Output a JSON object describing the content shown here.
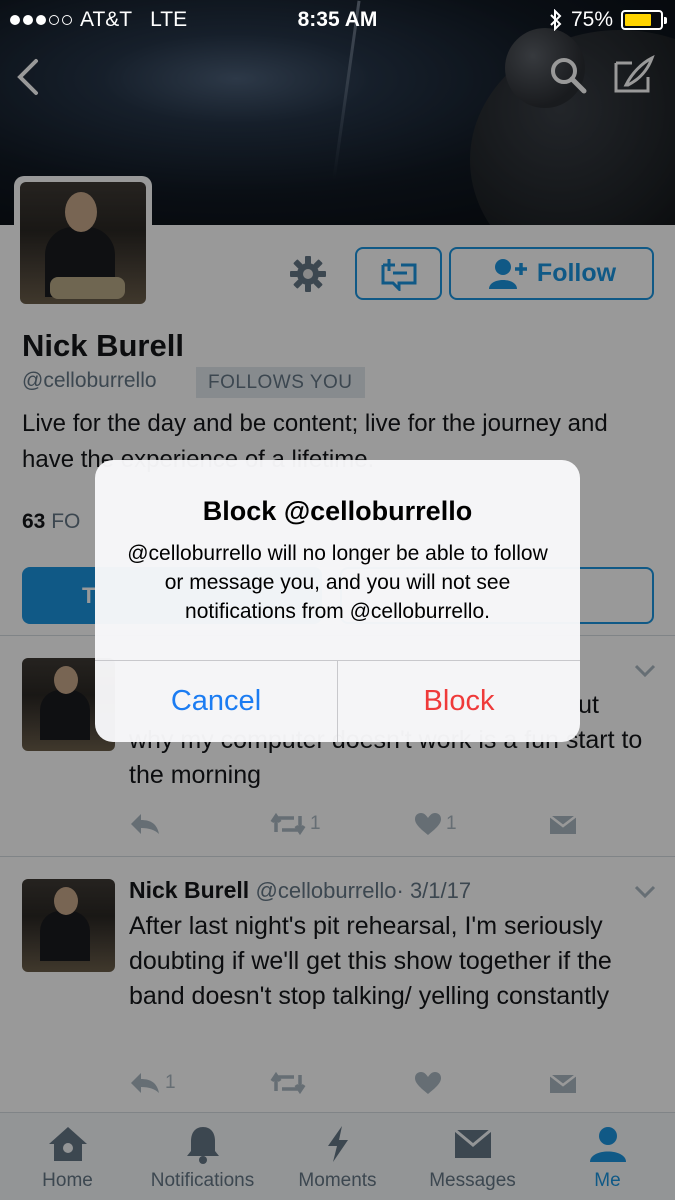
{
  "status_bar": {
    "carrier": "AT&T",
    "network": "LTE",
    "time": "8:35 AM",
    "battery": "75%",
    "battery_level": 0.75
  },
  "profile": {
    "name": "Nick Burell",
    "handle": "@celloburrello",
    "follows_you": "FOLLOWS YOU",
    "follow_label": "Follow",
    "bio": "Live for the day and be content; live for the journey and have the experience of a lifetime.",
    "stats_count": "63",
    "stats_label_partial": "FO",
    "tweets_tab_partial": "T"
  },
  "tweets": [
    {
      "text_partial_top": "ut",
      "text": "why my computer doesn't work is a fun start to the morning",
      "retweets": "1",
      "likes": "1",
      "replies": ""
    },
    {
      "name": "Nick Burell",
      "handle": "@celloburrello",
      "date": "· 3/1/17",
      "text": "After last night's pit rehearsal, I'm seriously doubting if we'll get this show together if the band doesn't stop talking/ yelling constantly",
      "replies": "1",
      "retweets": "",
      "likes": ""
    }
  ],
  "alert": {
    "title": "Block @celloburrello",
    "message": "@celloburrello will no longer be able to follow or message you, and you will not see notifications from @celloburrello.",
    "cancel": "Cancel",
    "confirm": "Block"
  },
  "tabbar": [
    {
      "label": "Home",
      "icon": "home-icon"
    },
    {
      "label": "Notifications",
      "icon": "bell-icon"
    },
    {
      "label": "Moments",
      "icon": "lightning-icon"
    },
    {
      "label": "Messages",
      "icon": "envelope-icon"
    },
    {
      "label": "Me",
      "icon": "person-icon",
      "active": true
    }
  ],
  "colors": {
    "accent": "#1b95e0",
    "destructive": "#ef3a3a",
    "ios_blue": "#1b7cf2"
  }
}
